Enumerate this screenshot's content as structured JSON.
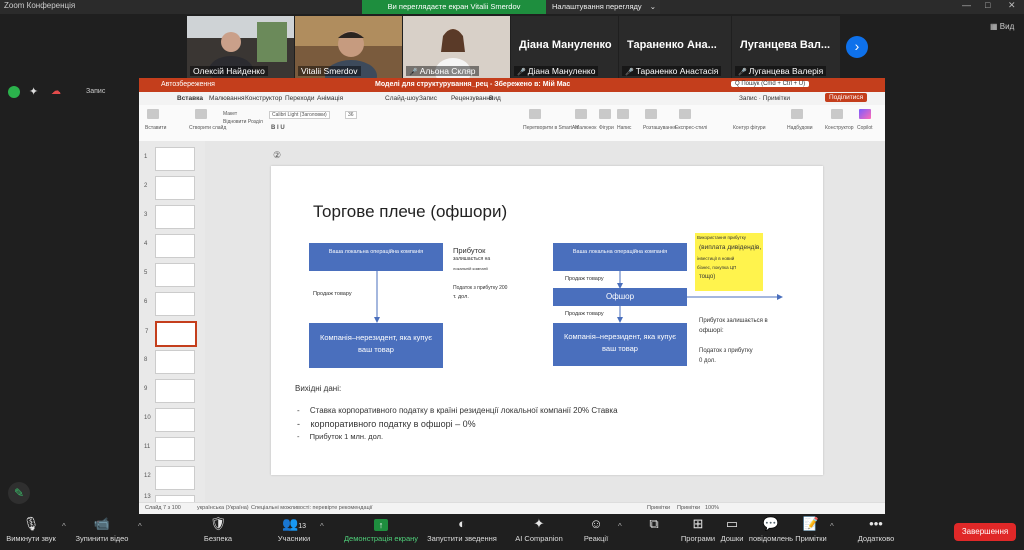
{
  "topbar": {
    "app_title": "Zoom Конференція",
    "share_banner": "Ви переглядаєте екран Vitalii Smerdov",
    "view_options": "Налаштування перегляду",
    "view_options_caret": "⌄",
    "min": "—",
    "restore": "□",
    "close": "✕"
  },
  "participants": [
    {
      "name": "Олексій Найденко",
      "muted": false,
      "video": true
    },
    {
      "name": "Vitalii Smerdov",
      "muted": false,
      "video": true
    },
    {
      "name": "Альона Скляр",
      "muted": true,
      "video": true
    },
    {
      "big": "Діана Мануленко",
      "name": "Діана Мануленко",
      "muted": true
    },
    {
      "big": "Тараненко Ана...",
      "name": "Тараненко Анастасія",
      "muted": true
    },
    {
      "big": "Луганцева Вал...",
      "name": "Луганцева Валерія",
      "muted": true
    }
  ],
  "view_button": "Вид",
  "recording": {
    "label": "Запис",
    "pause": "❚❚"
  },
  "ppt": {
    "title": "Моделі для структурування_рец - Збережено в: Мій Mac",
    "search": "Q Пошук (Cmd + Ctrl + U)",
    "record_btn": "Запис",
    "notes_btn": "Примітки",
    "share_btn": "Поділитися",
    "autosave": "Автозбереження",
    "tabs": [
      "Вставка",
      "Малювання",
      "Конструктор",
      "Переходи",
      "Анімація",
      "Слайд-шоу",
      "Запис",
      "Рецензування",
      "Вид"
    ],
    "ribbon": {
      "paste": "Вставити",
      "new_slide": "Створити слайд",
      "layout": "Макет",
      "reset": "Відновити Розділ",
      "font": "Calibri Light (Заголовки)",
      "size": "36",
      "convert": "Перетворити в SmartArt",
      "picture": "Малюнок",
      "shapes": "Фігури",
      "text_box": "Напис",
      "arrange": "Розташування",
      "quick_styles": "Експрес-стилі",
      "shape_outline": "Контур фігури",
      "designer": "Надбудови",
      "constructor": "Конструктор",
      "copilot": "Copilot"
    },
    "status": {
      "slide": "Слайд 7 з 100",
      "lang": "українська (Україна)",
      "access": "Спеціальні можливості: перевірте рекомендації",
      "notes": "Примітки",
      "comments": "Примітки",
      "zoom": "100%"
    },
    "thumb_numbers": [
      "1",
      "2",
      "3",
      "4",
      "5",
      "6",
      "7",
      "8",
      "9",
      "10",
      "11",
      "12",
      "13"
    ],
    "selected_thumb": 7
  },
  "slide": {
    "title": "Торгове плече (офшори)",
    "left": {
      "local_company": "Ваша локальна операційна компанія",
      "profit_label": "Прибуток",
      "profit_stays": "залишається на",
      "local_company_small": "локальній компанії",
      "tax_text": "Податок з прибутку 200",
      "tax_text2": "т. дол.",
      "sale_label": "Продаж товару",
      "nonresident": "Компанія–нерезидент, яка купує ваш товар"
    },
    "right": {
      "local_company": "Ваша локальна операційна компанія",
      "sale_label_1": "Продаж товару",
      "offshore": "Офшор",
      "sale_label_2": "Продаж товару",
      "nonresident": "Компанія–нерезидент, яка купує ваш товар",
      "hl_1": "Використання прибутку",
      "hl_2": "(виплата дивідендів,",
      "hl_3": "інвестиції в новий",
      "hl_4": "бізнес, покупка ЦП",
      "hl_5": "тощо)",
      "profit_offshore_1": "Прибуток залишається в",
      "profit_offshore_2": "офшорі:",
      "tax_1": "Податок з прибутку",
      "tax_2": "0 дол."
    },
    "inputs_title": "Вихідні дані:",
    "bullets": [
      "Ставка корпоративного податку в країні резиденції локальної компанії 20% Ставка",
      "корпоративного податку в офшорі – 0%",
      "Прибуток 1 млн. дол."
    ],
    "bullet_glyph": "-",
    "slide_badge": "②"
  },
  "toolbar": {
    "mute": "Вимкнути звук",
    "stop_video": "Зупинити відео",
    "security": "Безпека",
    "participants": "Учасники",
    "participants_count": "13",
    "share_screen": "Демонстрація екрану",
    "record": "Запустити зведення",
    "ai": "AI Companion",
    "reactions": "Реакції",
    "apps": "Програми",
    "whiteboards": "Дошки",
    "chat": "повідомлень",
    "notes": "Примітки",
    "more": "Додатково",
    "end": "Завершення",
    "caret": "^",
    "more_dots": "•••"
  },
  "colors": {
    "ppt_red": "#c43e1c",
    "box_blue": "#4a6fbd",
    "highlight": "#fff34d",
    "zoom_green": "#1e8e3e",
    "end_red": "#e02828"
  }
}
